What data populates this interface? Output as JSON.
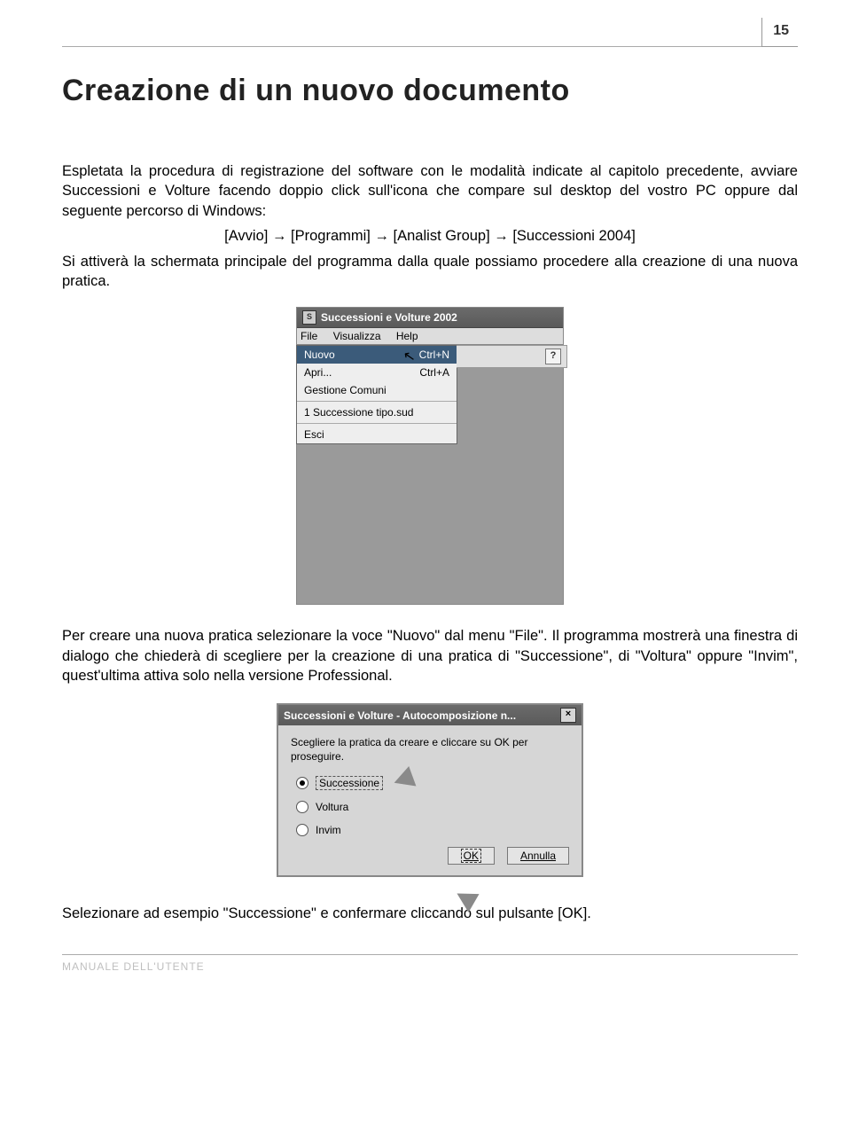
{
  "page_number": "15",
  "title": "Creazione di un nuovo documento",
  "para1": "Espletata la procedura di registrazione del software con le modalità indicate al capitolo precedente, avviare Successioni e Volture facendo doppio click sull'icona che compare sul desktop del vostro PC oppure dal seguente percorso di Windows:",
  "path_line": "[Avvio] → [Programmi] → [Analist Group] → [Successioni 2004]",
  "para2": "Si attiverà la schermata principale del programma dalla quale possiamo procedere alla creazione di una nuova pratica.",
  "screenshot1": {
    "icon_letter": "S",
    "title": "Successioni e Volture 2002",
    "menubar": {
      "file": "File",
      "visualizza": "Visualizza",
      "help": "Help"
    },
    "menu": {
      "nuovo": "Nuovo",
      "nuovo_sc": "Ctrl+N",
      "apri": "Apri...",
      "apri_sc": "Ctrl+A",
      "gestione": "Gestione Comuni",
      "recent": "1 Successione tipo.sud",
      "esci": "Esci"
    },
    "help_icon": "?"
  },
  "para3_a": "Per creare una nuova pratica selezionare la voce \"Nuovo\" dal menu \"File\". Il programma mostrerà una finestra di dialogo che chiederà di scegliere per la creazione di una pratica di \"Successione\", di \"Voltura\" oppure \"Invim\", quest'ultima attiva solo nella versione Professional.",
  "screenshot2": {
    "title": "Successioni e Volture - Autocomposizione n...",
    "close": "×",
    "instr": "Scegliere la pratica da creare e cliccare su OK per proseguire.",
    "opt1": "Successione",
    "opt2": "Voltura",
    "opt3": "Invim",
    "ok": "OK",
    "annulla": "Annulla"
  },
  "para4": "Selezionare ad esempio \"Successione\" e confermare cliccando sul pulsante [OK].",
  "footer": "MANUALE DELL'UTENTE"
}
